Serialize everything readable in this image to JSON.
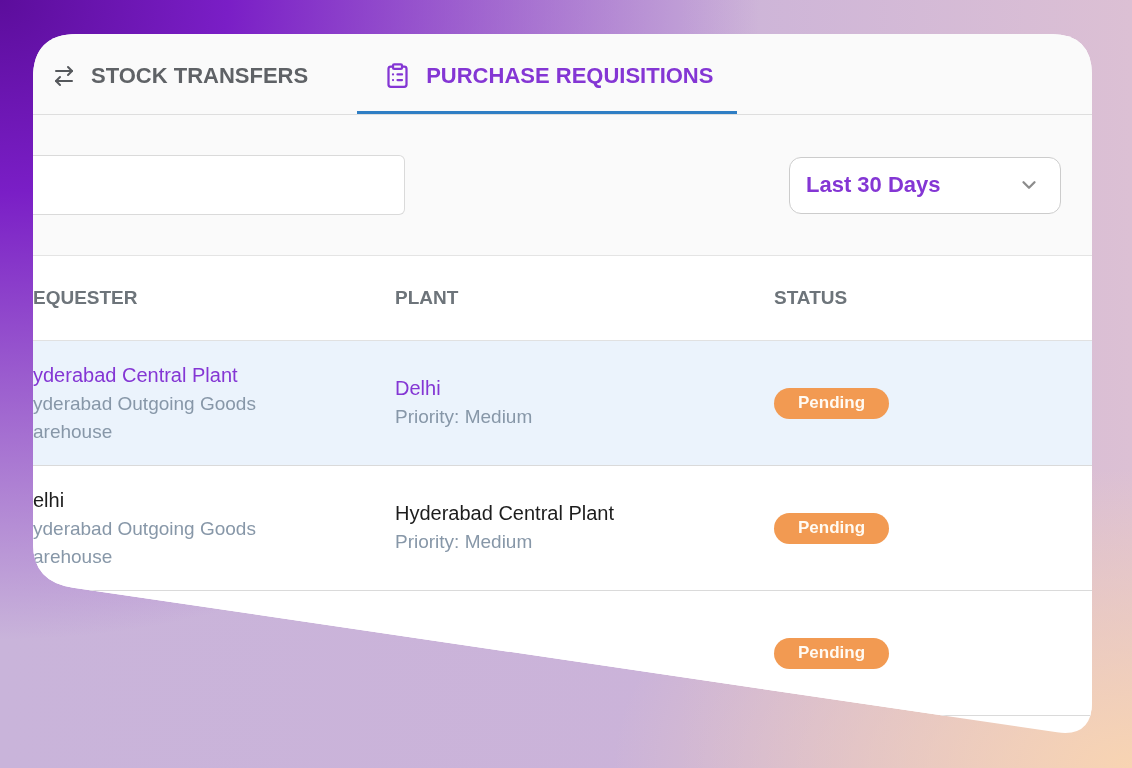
{
  "tabs": [
    {
      "label": "STOCK TRANSFERS",
      "selected": false
    },
    {
      "label": "PURCHASE REQUISITIONS",
      "selected": true
    }
  ],
  "toolbar": {
    "date_range": "Last 30 Days"
  },
  "table": {
    "columns": [
      "EQUESTER",
      "PLANT",
      "STATUS"
    ],
    "rows": [
      {
        "selected": true,
        "requester": {
          "name": "yderabad Central Plant",
          "location": "yderabad Outgoing Goods arehouse"
        },
        "plant": {
          "name": "Delhi",
          "priority": "Priority: Medium"
        },
        "status": "Pending"
      },
      {
        "selected": false,
        "requester": {
          "name": "elhi",
          "location": "yderabad Outgoing Goods arehouse"
        },
        "plant": {
          "name": "Hyderabad Central Plant",
          "priority": "Priority: Medium"
        },
        "status": "Pending"
      },
      {
        "selected": false,
        "status": "Pending"
      }
    ]
  }
}
